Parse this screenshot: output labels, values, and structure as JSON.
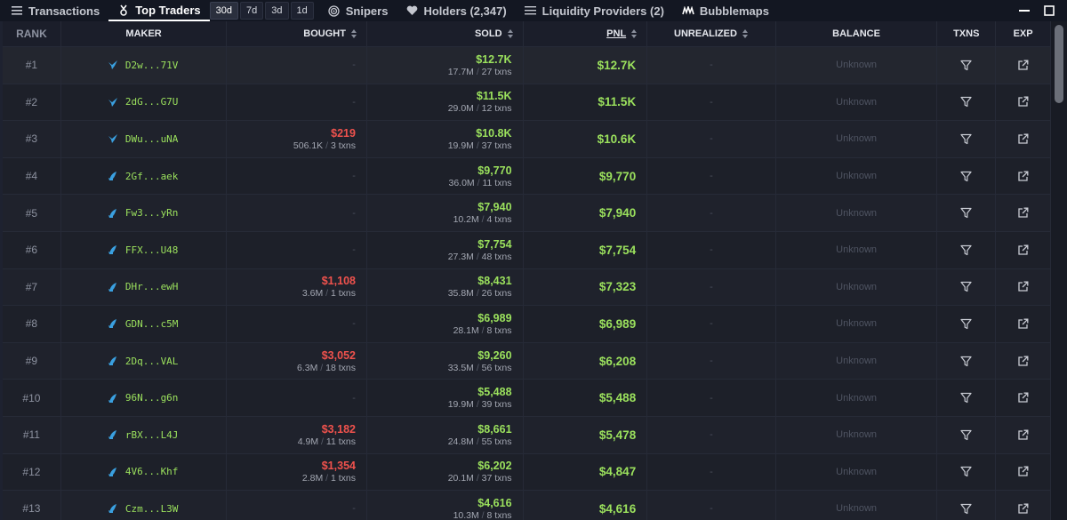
{
  "tabs": [
    {
      "label": "Transactions",
      "icon": "list-icon"
    },
    {
      "label": "Top Traders",
      "icon": "trophy-icon",
      "active": true
    },
    {
      "label": "Snipers",
      "icon": "target-icon"
    },
    {
      "label": "Holders (2,347)",
      "icon": "heart-icon"
    },
    {
      "label": "Liquidity Providers (2)",
      "icon": "liquidity-icon"
    },
    {
      "label": "Bubblemaps",
      "icon": "bubblemaps-icon"
    }
  ],
  "periods": [
    {
      "label": "30d",
      "active": true
    },
    {
      "label": "7d"
    },
    {
      "label": "3d"
    },
    {
      "label": "1d"
    }
  ],
  "columns": {
    "rank": "RANK",
    "maker": "MAKER",
    "bought": "BOUGHT",
    "sold": "SOLD",
    "pnl": "PNL",
    "unrealized": "UNREALIZED",
    "balance": "BALANCE",
    "txns": "TXNS",
    "exp": "EXP"
  },
  "placeholder_dash": "-",
  "rows": [
    {
      "rank": "#1",
      "maker": "D2w...71V",
      "icon": "bird",
      "bought": null,
      "sold": {
        "usd": "$12.7K",
        "amt": "17.7M",
        "txns": "27 txns"
      },
      "pnl": "$12.7K",
      "unrealized": "-",
      "balance": "Unknown"
    },
    {
      "rank": "#2",
      "maker": "2dG...G7U",
      "icon": "bird",
      "bought": null,
      "sold": {
        "usd": "$11.5K",
        "amt": "29.0M",
        "txns": "12 txns"
      },
      "pnl": "$11.5K",
      "unrealized": "-",
      "balance": "Unknown"
    },
    {
      "rank": "#3",
      "maker": "DWu...uNA",
      "icon": "bird",
      "bought": {
        "usd": "$219",
        "amt": "506.1K",
        "txns": "3 txns"
      },
      "sold": {
        "usd": "$10.8K",
        "amt": "19.9M",
        "txns": "37 txns"
      },
      "pnl": "$10.6K",
      "unrealized": "-",
      "balance": "Unknown"
    },
    {
      "rank": "#4",
      "maker": "2Gf...aek",
      "icon": "fish",
      "bought": null,
      "sold": {
        "usd": "$9,770",
        "amt": "36.0M",
        "txns": "11 txns"
      },
      "pnl": "$9,770",
      "unrealized": "-",
      "balance": "Unknown"
    },
    {
      "rank": "#5",
      "maker": "Fw3...yRn",
      "icon": "fish",
      "bought": null,
      "sold": {
        "usd": "$7,940",
        "amt": "10.2M",
        "txns": "4 txns"
      },
      "pnl": "$7,940",
      "unrealized": "-",
      "balance": "Unknown"
    },
    {
      "rank": "#6",
      "maker": "FFX...U48",
      "icon": "fish",
      "bought": null,
      "sold": {
        "usd": "$7,754",
        "amt": "27.3M",
        "txns": "48 txns"
      },
      "pnl": "$7,754",
      "unrealized": "-",
      "balance": "Unknown"
    },
    {
      "rank": "#7",
      "maker": "DHr...ewH",
      "icon": "fish",
      "bought": {
        "usd": "$1,108",
        "amt": "3.6M",
        "txns": "1 txns"
      },
      "sold": {
        "usd": "$8,431",
        "amt": "35.8M",
        "txns": "26 txns"
      },
      "pnl": "$7,323",
      "unrealized": "-",
      "balance": "Unknown"
    },
    {
      "rank": "#8",
      "maker": "GDN...c5M",
      "icon": "fish",
      "bought": null,
      "sold": {
        "usd": "$6,989",
        "amt": "28.1M",
        "txns": "8 txns"
      },
      "pnl": "$6,989",
      "unrealized": "-",
      "balance": "Unknown"
    },
    {
      "rank": "#9",
      "maker": "2Dq...VAL",
      "icon": "fish",
      "bought": {
        "usd": "$3,052",
        "amt": "6.3M",
        "txns": "18 txns"
      },
      "sold": {
        "usd": "$9,260",
        "amt": "33.5M",
        "txns": "56 txns"
      },
      "pnl": "$6,208",
      "unrealized": "-",
      "balance": "Unknown"
    },
    {
      "rank": "#10",
      "maker": "96N...g6n",
      "icon": "fish",
      "bought": null,
      "sold": {
        "usd": "$5,488",
        "amt": "19.9M",
        "txns": "39 txns"
      },
      "pnl": "$5,488",
      "unrealized": "-",
      "balance": "Unknown"
    },
    {
      "rank": "#11",
      "maker": "rBX...L4J",
      "icon": "fish",
      "bought": {
        "usd": "$3,182",
        "amt": "4.9M",
        "txns": "11 txns"
      },
      "sold": {
        "usd": "$8,661",
        "amt": "24.8M",
        "txns": "55 txns"
      },
      "pnl": "$5,478",
      "unrealized": "-",
      "balance": "Unknown"
    },
    {
      "rank": "#12",
      "maker": "4V6...Khf",
      "icon": "fish",
      "bought": {
        "usd": "$1,354",
        "amt": "2.8M",
        "txns": "1 txns"
      },
      "sold": {
        "usd": "$6,202",
        "amt": "20.1M",
        "txns": "37 txns"
      },
      "pnl": "$4,847",
      "unrealized": "-",
      "balance": "Unknown"
    },
    {
      "rank": "#13",
      "maker": "Czm...L3W",
      "icon": "fish",
      "bought": null,
      "sold": {
        "usd": "$4,616",
        "amt": "10.3M",
        "txns": "8 txns"
      },
      "pnl": "$4,616",
      "unrealized": "-",
      "balance": "Unknown"
    }
  ],
  "colors": {
    "positive": "#9be15d",
    "negative": "#f0524d",
    "background": "#131722",
    "icon_blue": "#3aa0e0"
  }
}
